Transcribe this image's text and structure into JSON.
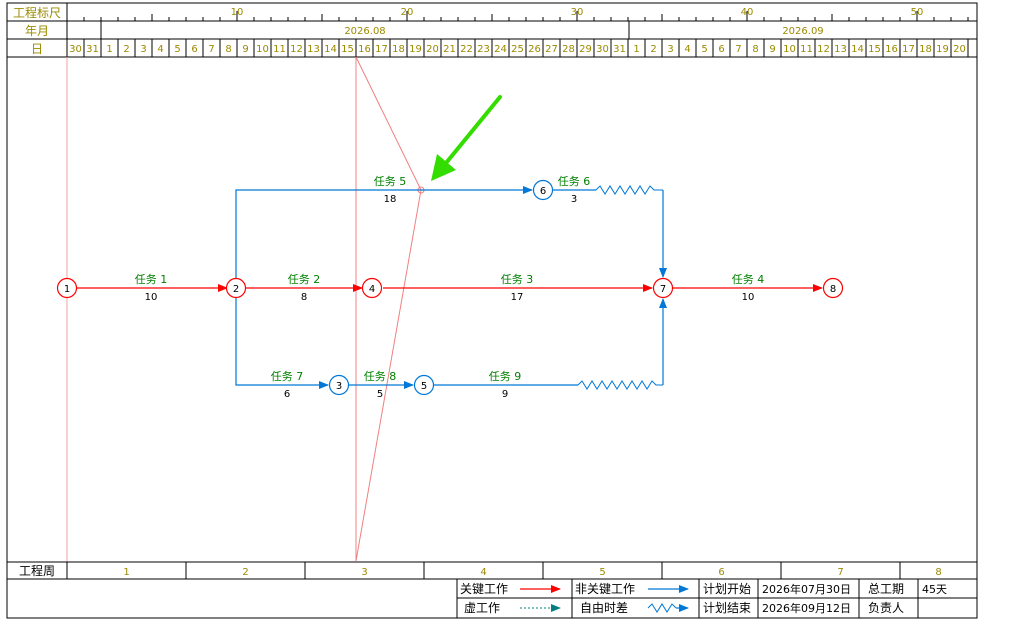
{
  "header": {
    "ruler_label": "工程标尺",
    "month_label": "年月",
    "day_label": "日",
    "ruler_ticks": [
      "10",
      "20",
      "30",
      "40",
      "50"
    ],
    "months": [
      "2026.08",
      "2026.09"
    ],
    "days": [
      "30",
      "31",
      "1",
      "2",
      "3",
      "4",
      "5",
      "6",
      "7",
      "8",
      "9",
      "10",
      "11",
      "12",
      "13",
      "14",
      "15",
      "16",
      "17",
      "18",
      "19",
      "20",
      "21",
      "22",
      "23",
      "24",
      "25",
      "26",
      "27",
      "28",
      "29",
      "30",
      "31",
      "1",
      "2",
      "3",
      "4",
      "5",
      "6",
      "7",
      "8",
      "9",
      "10",
      "11",
      "12",
      "13",
      "14",
      "15",
      "16",
      "17",
      "18",
      "19",
      "20"
    ]
  },
  "colors": {
    "critical": "#ff0000",
    "non_critical": "#0078d7",
    "task_name": "#008000",
    "scale_text": "#9b8a00",
    "today_line": "#f08080",
    "pointer_arrow": "#33dd00",
    "dummy": "#008080"
  },
  "nodes": [
    {
      "id": "1",
      "critical": true
    },
    {
      "id": "2",
      "critical": true
    },
    {
      "id": "3",
      "critical": false
    },
    {
      "id": "4",
      "critical": true
    },
    {
      "id": "5",
      "critical": false
    },
    {
      "id": "6",
      "critical": false
    },
    {
      "id": "7",
      "critical": true
    },
    {
      "id": "8",
      "critical": true
    }
  ],
  "tasks": [
    {
      "name": "任务 1",
      "duration": "10",
      "from": "1",
      "to": "2",
      "critical": true
    },
    {
      "name": "任务 2",
      "duration": "8",
      "from": "2",
      "to": "4",
      "critical": true
    },
    {
      "name": "任务 3",
      "duration": "17",
      "from": "4",
      "to": "7",
      "critical": true
    },
    {
      "name": "任务 4",
      "duration": "10",
      "from": "7",
      "to": "8",
      "critical": true
    },
    {
      "name": "任务 5",
      "duration": "18",
      "from": "2",
      "to": "6",
      "critical": false
    },
    {
      "name": "任务 6",
      "duration": "3",
      "from": "6",
      "to": "7",
      "critical": false
    },
    {
      "name": "任务 7",
      "duration": "6",
      "from": "2",
      "to": "3",
      "critical": false
    },
    {
      "name": "任务 8",
      "duration": "5",
      "from": "3",
      "to": "5",
      "critical": false
    },
    {
      "name": "任务 9",
      "duration": "9",
      "from": "5",
      "to": "7",
      "critical": false
    }
  ],
  "footer": {
    "week_label": "工程周",
    "weeks": [
      "1",
      "2",
      "3",
      "4",
      "5",
      "6",
      "7",
      "8"
    ],
    "legend": {
      "critical": "关键工作",
      "non_critical": "非关键工作",
      "dummy": "虚工作",
      "free_float": "自由时差"
    },
    "plan_start_label": "计划开始",
    "plan_start_value": "2026年07月30日",
    "plan_end_label": "计划结束",
    "plan_end_value": "2026年09月12日",
    "total_duration_label": "总工期",
    "total_duration_value": "45天",
    "owner_label": "负责人",
    "owner_value": ""
  }
}
